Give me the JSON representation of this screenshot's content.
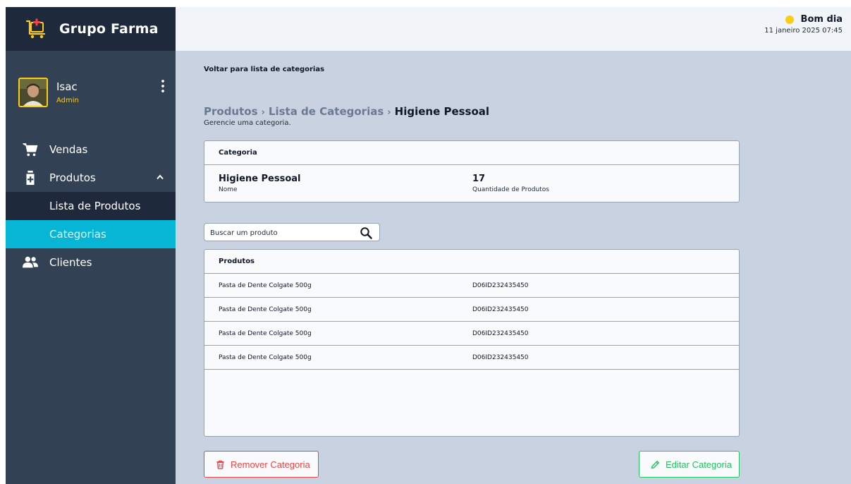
{
  "brand": {
    "name": "Grupo Farma"
  },
  "user": {
    "name": "Isac",
    "role": "Admin"
  },
  "nav": {
    "vendas": "Vendas",
    "produtos": "Produtos",
    "lista_produtos": "Lista de Produtos",
    "categorias": "Categorias",
    "clientes": "Clientes"
  },
  "topbar": {
    "greeting": "Bom dia",
    "datetime": "11 janeiro 2025  07:45"
  },
  "main": {
    "back_link": "Voltar para lista de categorias",
    "breadcrumb": [
      "Produtos",
      "Lista de Categorias",
      "Higiene Pessoal"
    ],
    "breadcrumb_sep": "›",
    "subtitle": "Gerencie uma categoria."
  },
  "category_card": {
    "header": "Categoria",
    "name_value": "Higiene Pessoal",
    "name_label": "Nome",
    "count_value": "17",
    "count_label": "Quantidade de Produtos"
  },
  "search": {
    "placeholder": "Buscar um produto",
    "value": ""
  },
  "products": {
    "header": "Produtos",
    "rows": [
      {
        "name": "Pasta de Dente Colgate 500g",
        "code": "D06ID232435450"
      },
      {
        "name": "Pasta de Dente Colgate 500g",
        "code": "D06ID232435450"
      },
      {
        "name": "Pasta de Dente Colgate 500g",
        "code": "D06ID232435450"
      },
      {
        "name": "Pasta de Dente Colgate 500g",
        "code": "D06ID232435450"
      }
    ]
  },
  "actions": {
    "remove": "Remover Categoria",
    "edit": "Editar Categoria"
  },
  "colors": {
    "sidebar": "#334155",
    "sidebar_dark": "#1e293b",
    "active": "#06b6d4",
    "accent_yellow": "#facc15",
    "danger": "#ef4444",
    "success": "#22c55e",
    "main_bg": "#c8d2e1"
  },
  "icons": {
    "brand": "pharmacy-cart-icon",
    "menu": "vertical-dots-icon",
    "vendas": "shopping-cart-icon",
    "produtos": "medicine-bottle-icon",
    "clientes": "users-icon",
    "chevron": "chevron-up-icon",
    "search": "search-icon",
    "remove": "trash-icon",
    "edit": "pencil-icon"
  }
}
